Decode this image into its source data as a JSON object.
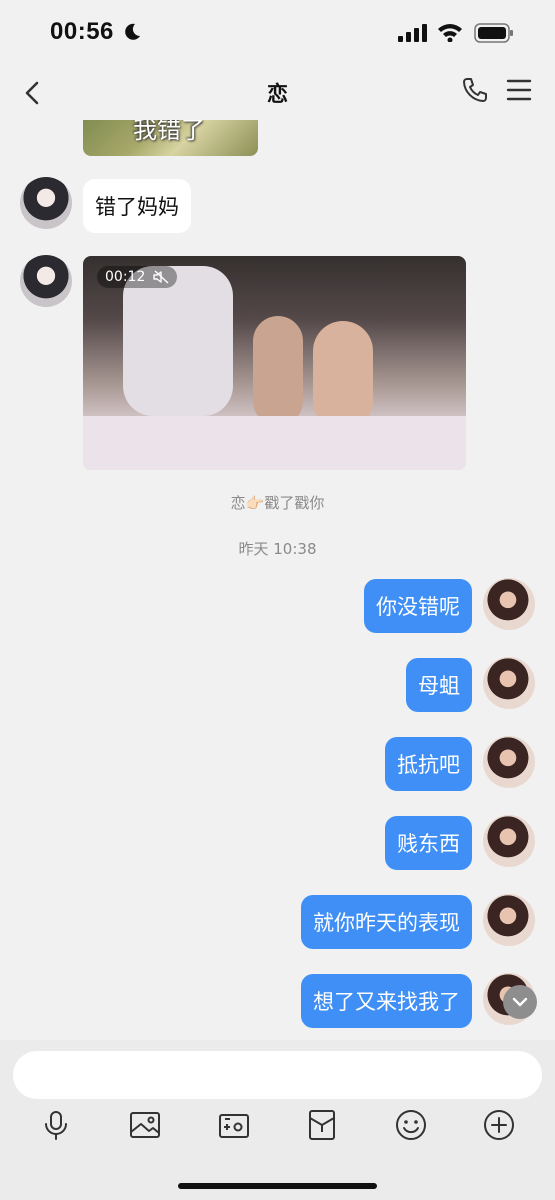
{
  "status_bar": {
    "time": "00:56"
  },
  "nav": {
    "title": "恋"
  },
  "sticker": {
    "text": "我错了"
  },
  "messages_in": [
    {
      "text": "错了妈妈"
    }
  ],
  "video": {
    "duration": "00:12"
  },
  "system": {
    "poke": "恋👉🏻戳了戳你",
    "timestamp": "昨天 10:38"
  },
  "messages_out": [
    {
      "text": "你没错呢"
    },
    {
      "text": "母蛆"
    },
    {
      "text": "抵抗吧"
    },
    {
      "text": "贱东西"
    },
    {
      "text": "就你昨天的表现"
    },
    {
      "text": "想了又来找我了"
    }
  ],
  "input": {
    "placeholder": ""
  },
  "colors": {
    "outgoing_bubble": "#3f8ff6",
    "incoming_bubble": "#ffffff",
    "background": "#f1f1f1"
  }
}
